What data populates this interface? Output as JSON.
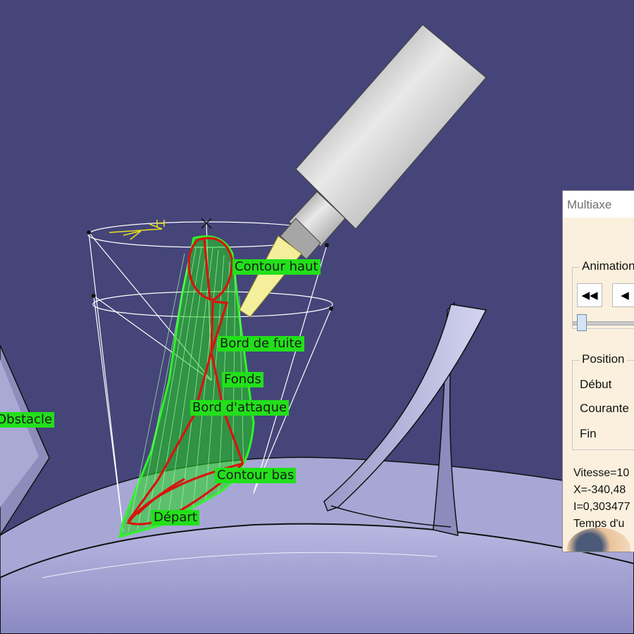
{
  "scene": {
    "labels": {
      "contour_haut": "Contour haut",
      "bord_de_fuite": "Bord de fuite",
      "fonds": "Fonds",
      "bord_attaque": "Bord d'attaque",
      "obstacle": "Obstacle",
      "contour_bas": "Contour bas",
      "depart": "Départ"
    },
    "colors": {
      "background": "#45457a",
      "label_green": "#22e01a",
      "path_red": "#d8140c",
      "toolpath_green": "#1fd41a"
    }
  },
  "dialog": {
    "title": "Multiaxe",
    "animation_group": "Animation",
    "buttons": [
      "rewind-icon",
      "step-back-icon"
    ],
    "position_group": "Position",
    "positions": [
      "Début",
      "Courante",
      "Fin"
    ],
    "info": [
      "Vitesse=10",
      "X=-340,48",
      "I=0,303477",
      "Temps d'u"
    ]
  }
}
